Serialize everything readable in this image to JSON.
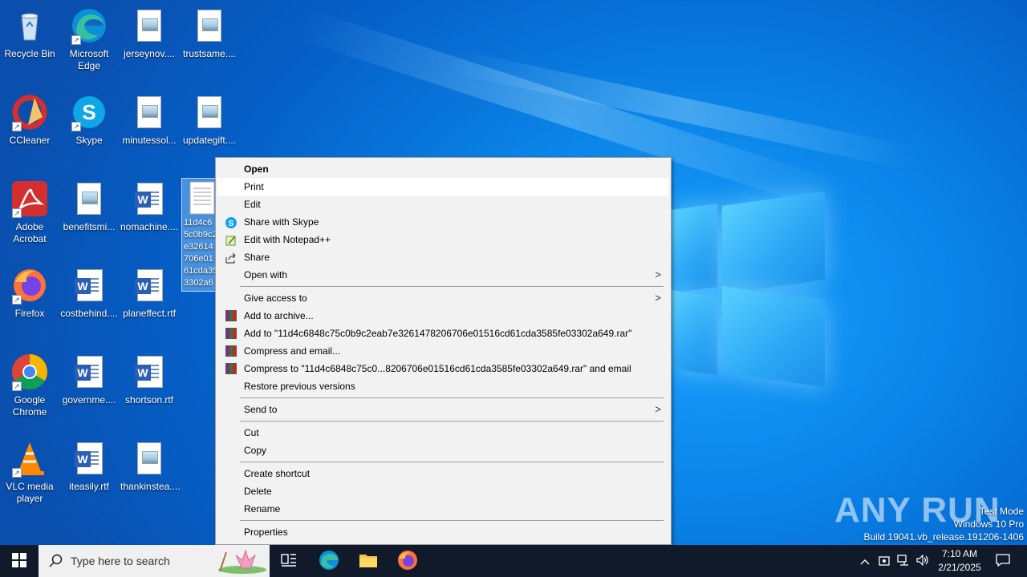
{
  "desktop": {
    "icons": [
      {
        "label": "Recycle Bin",
        "icon": "recycle-bin-icon"
      },
      {
        "label": "Microsoft Edge",
        "icon": "edge-icon"
      },
      {
        "label": "jerseynov....",
        "icon": "image-file-icon"
      },
      {
        "label": "trustsame....",
        "icon": "image-file-icon"
      },
      {
        "label": "CCleaner",
        "icon": "ccleaner-icon"
      },
      {
        "label": "Skype",
        "icon": "skype-icon"
      },
      {
        "label": "minutessol...",
        "icon": "image-file-icon"
      },
      {
        "label": "updategift....",
        "icon": "image-file-icon"
      },
      {
        "label": "Adobe Acrobat",
        "icon": "acrobat-icon"
      },
      {
        "label": "benefitsmi...",
        "icon": "image-file-icon"
      },
      {
        "label": "nomachine....",
        "icon": "word-file-icon"
      },
      {
        "label": "11d4c6848c75c0b9c2eab7e3261478206706e01516cd61cda3585fe03302a649",
        "icon": "text-file-icon"
      },
      {
        "label": "Firefox",
        "icon": "firefox-icon"
      },
      {
        "label": "costbehind....",
        "icon": "word-file-icon"
      },
      {
        "label": "planeffect.rtf",
        "icon": "word-file-icon"
      },
      {
        "label": "Google Chrome",
        "icon": "chrome-icon"
      },
      {
        "label": "governme....",
        "icon": "word-file-icon"
      },
      {
        "label": "shortson.rtf",
        "icon": "word-file-icon"
      },
      {
        "label": "VLC media player",
        "icon": "vlc-icon"
      },
      {
        "label": "iteasily.rtf",
        "icon": "word-file-icon"
      },
      {
        "label": "thankinstea....",
        "icon": "image-file-icon"
      }
    ],
    "selected_label_lines": [
      "11d4c6",
      "5c0b9c2",
      "e32614",
      "706e01",
      "61cda35",
      "3302a6"
    ]
  },
  "context_menu": {
    "items": [
      {
        "label": "Open"
      },
      {
        "label": "Print"
      },
      {
        "label": "Edit"
      },
      {
        "label": "Share with Skype",
        "icon": "skype-icon"
      },
      {
        "label": "Edit with Notepad++",
        "icon": "notepadpp-icon"
      },
      {
        "label": "Share",
        "icon": "share-icon"
      },
      {
        "label": "Open with"
      },
      {
        "label": "Give access to"
      },
      {
        "label": "Add to archive...",
        "icon": "winrar-icon"
      },
      {
        "label": "Add to \"11d4c6848c75c0b9c2eab7e3261478206706e01516cd61cda3585fe03302a649.rar\"",
        "icon": "winrar-icon"
      },
      {
        "label": "Compress and email...",
        "icon": "winrar-icon"
      },
      {
        "label": "Compress to \"11d4c6848c75c0...8206706e01516cd61cda3585fe03302a649.rar\" and email",
        "icon": "winrar-icon"
      },
      {
        "label": "Restore previous versions"
      },
      {
        "label": "Send to"
      },
      {
        "label": "Cut"
      },
      {
        "label": "Copy"
      },
      {
        "label": "Create shortcut"
      },
      {
        "label": "Delete"
      },
      {
        "label": "Rename"
      },
      {
        "label": "Properties"
      }
    ]
  },
  "taskbar": {
    "search_placeholder": "Type here to search",
    "clock_time": "7:10 AM",
    "clock_date": "2/21/2025",
    "background": "#101a2b"
  },
  "watermark": {
    "brand": "ANY RUN",
    "mode": "Test Mode",
    "edition": "Windows 10 Pro",
    "build": "Build 19041.vb_release.191206-1406"
  }
}
